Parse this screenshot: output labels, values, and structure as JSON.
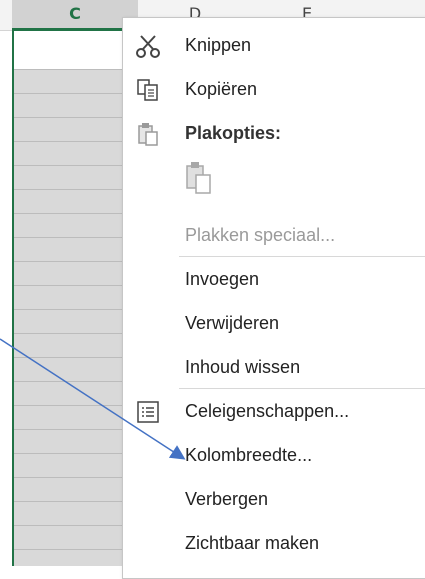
{
  "columns": {
    "c": "C",
    "d": "D",
    "e": "E"
  },
  "menu": {
    "items": [
      {
        "label": "Knippen",
        "icon": "scissors-icon"
      },
      {
        "label": "Kopiëren",
        "icon": "copy-icon"
      },
      {
        "label": "Plakopties:",
        "icon": "paste-icon"
      },
      {
        "label": "Plakken speciaal..."
      },
      {
        "label": "Invoegen"
      },
      {
        "label": "Verwijderen"
      },
      {
        "label": "Inhoud wissen"
      },
      {
        "label": "Celeigenschappen...",
        "icon": "format-cells-icon"
      },
      {
        "label": "Kolombreedte..."
      },
      {
        "label": "Verbergen"
      },
      {
        "label": "Zichtbaar maken"
      }
    ]
  },
  "colors": {
    "accent": "#217346",
    "arrow": "#4472c4"
  }
}
